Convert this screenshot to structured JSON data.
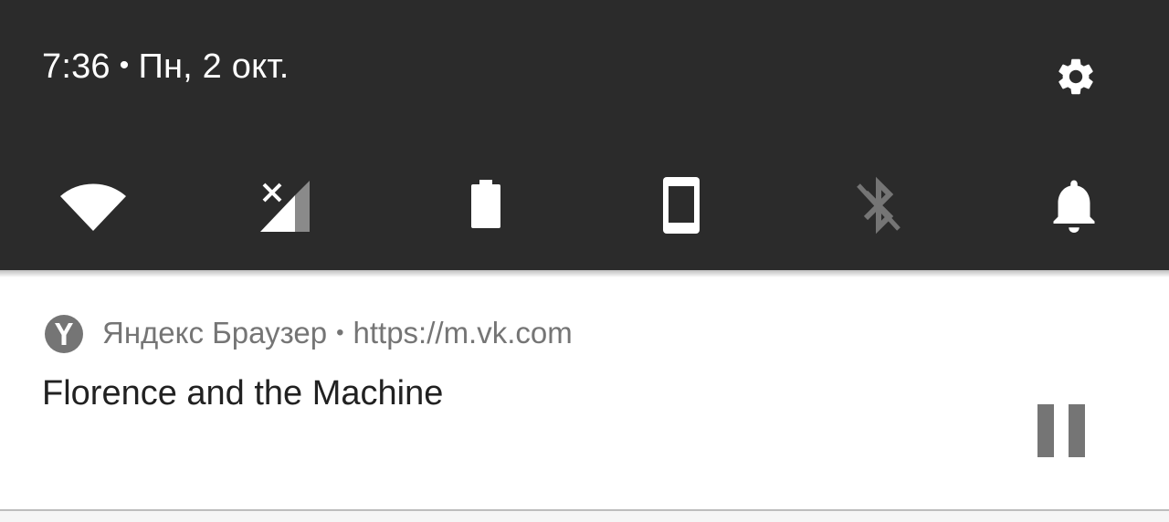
{
  "status_bar": {
    "time": "7:36",
    "separator": "•",
    "date": "Пн, 2 окт.",
    "settings_icon": "gear-icon"
  },
  "quick_settings": {
    "tiles": [
      {
        "icon": "wifi-icon",
        "state": "on"
      },
      {
        "icon": "mobile-signal-icon",
        "state": "no-signal"
      },
      {
        "icon": "battery-icon",
        "state": "full"
      },
      {
        "icon": "auto-rotate-icon",
        "state": "portrait"
      },
      {
        "icon": "bluetooth-icon",
        "state": "disabled"
      },
      {
        "icon": "bell-icon",
        "state": "sound-on"
      }
    ]
  },
  "notification": {
    "app_icon": "yandex-browser-icon",
    "app_name": "Яндекс Браузер",
    "separator": "•",
    "source_url": "https://m.vk.com",
    "title": "Florence and the Machine",
    "action_icon": "pause-icon"
  },
  "colors": {
    "shade_bg": "#2b2b2b",
    "icon_white": "#ffffff",
    "icon_disabled": "#757575",
    "notif_secondary": "#757575",
    "notif_title": "#212121",
    "pause_gray": "#757575"
  }
}
